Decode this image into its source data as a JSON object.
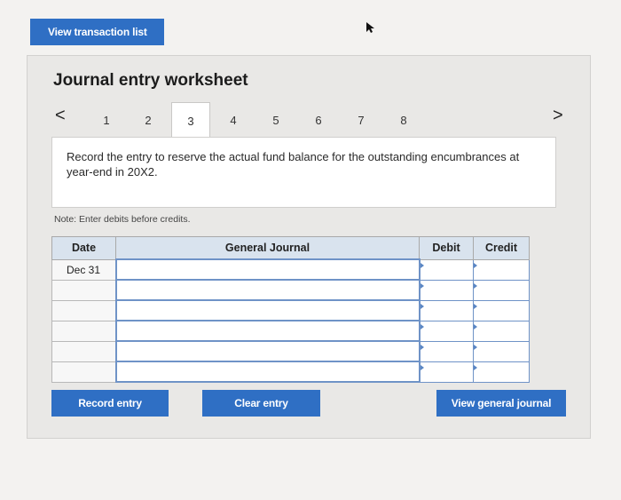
{
  "top": {
    "view_transaction_label": "View transaction list"
  },
  "worksheet": {
    "title": "Journal entry worksheet",
    "tabs": [
      "1",
      "2",
      "3",
      "4",
      "5",
      "6",
      "7",
      "8"
    ],
    "active_tab": "3",
    "prev_arrow": "<",
    "next_arrow": ">",
    "instruction": "Record the entry to reserve the actual fund balance for the outstanding encumbrances at year-end in 20X2.",
    "note": "Note: Enter debits before credits."
  },
  "journal": {
    "headers": {
      "date": "Date",
      "general_journal": "General Journal",
      "debit": "Debit",
      "credit": "Credit"
    },
    "rows": [
      {
        "date": "Dec 31",
        "account": "",
        "debit": "",
        "credit": ""
      },
      {
        "date": "",
        "account": "",
        "debit": "",
        "credit": ""
      },
      {
        "date": "",
        "account": "",
        "debit": "",
        "credit": ""
      },
      {
        "date": "",
        "account": "",
        "debit": "",
        "credit": ""
      },
      {
        "date": "",
        "account": "",
        "debit": "",
        "credit": ""
      },
      {
        "date": "",
        "account": "",
        "debit": "",
        "credit": ""
      }
    ]
  },
  "buttons": {
    "record": "Record entry",
    "clear": "Clear entry",
    "view_general_journal": "View general journal"
  },
  "colors": {
    "button": "#2f6fc4",
    "header_bg": "#d9e3ee",
    "field_border": "#6f93c7"
  }
}
